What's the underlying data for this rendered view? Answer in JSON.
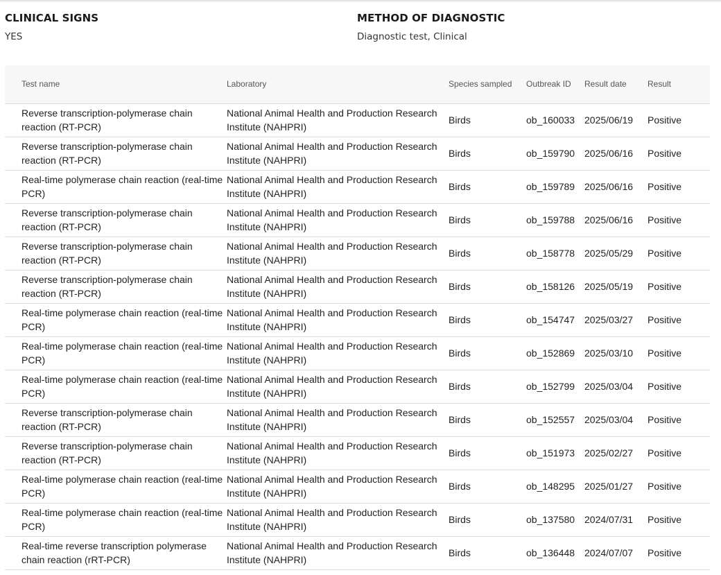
{
  "summary": {
    "clinical_signs": {
      "title": "CLINICAL SIGNS",
      "value": "YES"
    },
    "method": {
      "title": "METHOD OF DIAGNOSTIC",
      "value": "Diagnostic test, Clinical"
    }
  },
  "table": {
    "headers": [
      "Test name",
      "Laboratory",
      "Species sampled",
      "Outbreak ID",
      "Result date",
      "Result"
    ],
    "rows": [
      [
        "Reverse transcription-polymerase chain reaction (RT-PCR)",
        "National Animal Health and Production Research Institute (NAHPRI)",
        "Birds",
        "ob_160033",
        "2025/06/19",
        "Positive"
      ],
      [
        "Reverse transcription-polymerase chain reaction (RT-PCR)",
        "National Animal Health and Production Research Institute (NAHPRI)",
        "Birds",
        "ob_159790",
        "2025/06/16",
        "Positive"
      ],
      [
        "Real-time polymerase chain reaction (real-time PCR)",
        "National Animal Health and Production Research Institute (NAHPRI)",
        "Birds",
        "ob_159789",
        "2025/06/16",
        "Positive"
      ],
      [
        "Reverse transcription-polymerase chain reaction (RT-PCR)",
        "National Animal Health and Production Research Institute (NAHPRI)",
        "Birds",
        "ob_159788",
        "2025/06/16",
        "Positive"
      ],
      [
        "Reverse transcription-polymerase chain reaction (RT-PCR)",
        "National Animal Health and Production Research Institute (NAHPRI)",
        "Birds",
        "ob_158778",
        "2025/05/29",
        "Positive"
      ],
      [
        "Reverse transcription-polymerase chain reaction (RT-PCR)",
        "National Animal Health and Production Research Institute (NAHPRI)",
        "Birds",
        "ob_158126",
        "2025/05/19",
        "Positive"
      ],
      [
        "Real-time polymerase chain reaction (real-time PCR)",
        "National Animal Health and Production Research Institute (NAHPRI)",
        "Birds",
        "ob_154747",
        "2025/03/27",
        "Positive"
      ],
      [
        "Real-time polymerase chain reaction (real-time PCR)",
        "National Animal Health and Production Research Institute (NAHPRI)",
        "Birds",
        "ob_152869",
        "2025/03/10",
        "Positive"
      ],
      [
        "Real-time polymerase chain reaction (real-time PCR)",
        "National Animal Health and Production Research Institute (NAHPRI)",
        "Birds",
        "ob_152799",
        "2025/03/04",
        "Positive"
      ],
      [
        "Reverse transcription-polymerase chain reaction (RT-PCR)",
        "National Animal Health and Production Research Institute (NAHPRI)",
        "Birds",
        "ob_152557",
        "2025/03/04",
        "Positive"
      ],
      [
        "Reverse transcription-polymerase chain reaction (RT-PCR)",
        "National Animal Health and Production Research Institute (NAHPRI)",
        "Birds",
        "ob_151973",
        "2025/02/27",
        "Positive"
      ],
      [
        "Real-time polymerase chain reaction (real-time PCR)",
        "National Animal Health and Production Research Institute (NAHPRI)",
        "Birds",
        "ob_148295",
        "2025/01/27",
        "Positive"
      ],
      [
        "Real-time polymerase chain reaction (real-time PCR)",
        "National Animal Health and Production Research Institute (NAHPRI)",
        "Birds",
        "ob_137580",
        "2024/07/31",
        "Positive"
      ],
      [
        "Real-time reverse transcription polymerase chain reaction (rRT-PCR)",
        "National Animal Health and Production Research Institute (NAHPRI)",
        "Birds",
        "ob_136448",
        "2024/07/07",
        "Positive"
      ]
    ]
  }
}
